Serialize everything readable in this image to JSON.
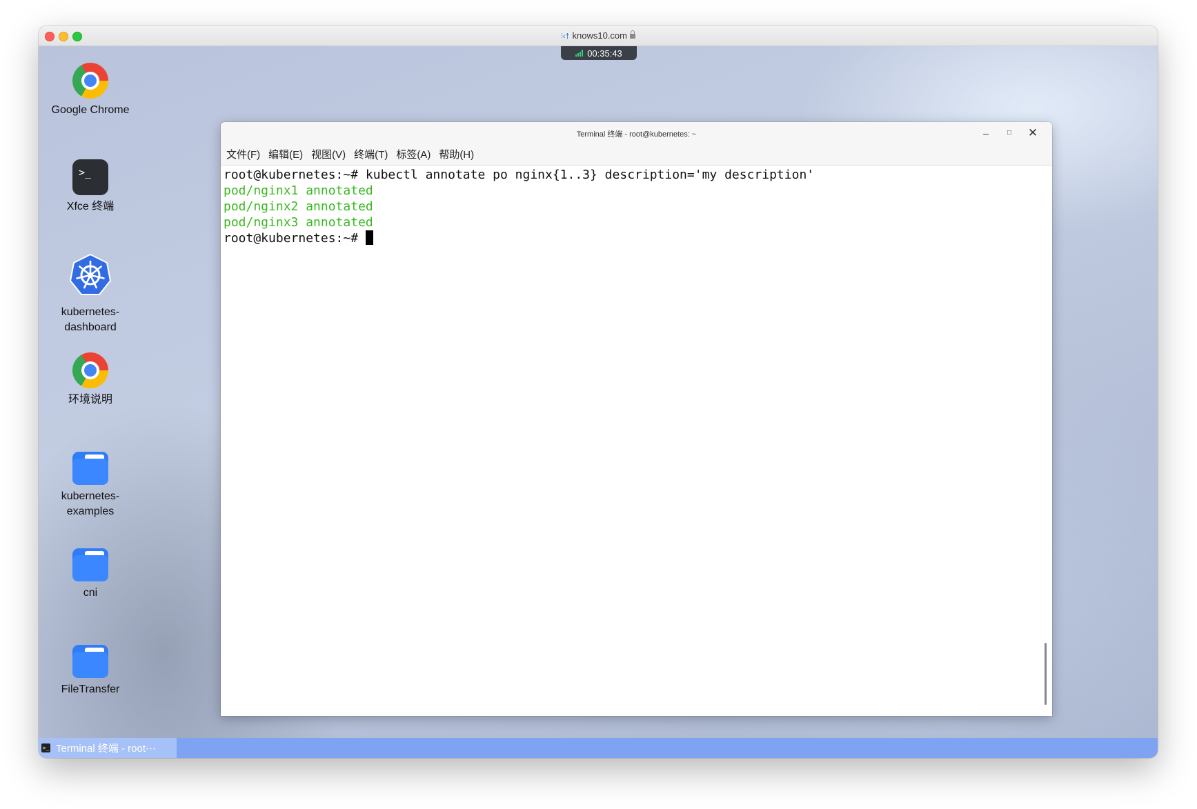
{
  "browser": {
    "host": "knows10.com",
    "host_icon": "remote-desktop-icon",
    "timer": "00:35:43"
  },
  "desktop": {
    "icons": [
      {
        "label": "Google Chrome",
        "icon": "chrome-icon"
      },
      {
        "label": "Xfce 终端",
        "icon": "terminal-icon"
      },
      {
        "label": "kubernetes-\ndashboard",
        "icon": "kubernetes-icon"
      },
      {
        "label": "环境说明",
        "icon": "chrome-icon"
      },
      {
        "label": "kubernetes-\nexamples",
        "icon": "folder-icon"
      },
      {
        "label": "cni",
        "icon": "folder-icon"
      },
      {
        "label": "FileTransfer",
        "icon": "folder-icon"
      }
    ]
  },
  "terminal": {
    "title": "Terminal 终端 - root@kubernetes: ~",
    "menu": [
      "文件(F)",
      "编辑(E)",
      "视图(V)",
      "终端(T)",
      "标签(A)",
      "帮助(H)"
    ],
    "lines": [
      {
        "text": "root@kubernetes:~# kubectl annotate po nginx{1..3} description='my description'",
        "style": "normal"
      },
      {
        "text": "pod/nginx1 annotated",
        "style": "ok"
      },
      {
        "text": "pod/nginx2 annotated",
        "style": "ok"
      },
      {
        "text": "pod/nginx3 annotated",
        "style": "ok"
      }
    ],
    "prompt": "root@kubernetes:~# ",
    "output_color": "#3bb821"
  },
  "taskbar": {
    "item_label": "Terminal 终端 - root⋯"
  }
}
